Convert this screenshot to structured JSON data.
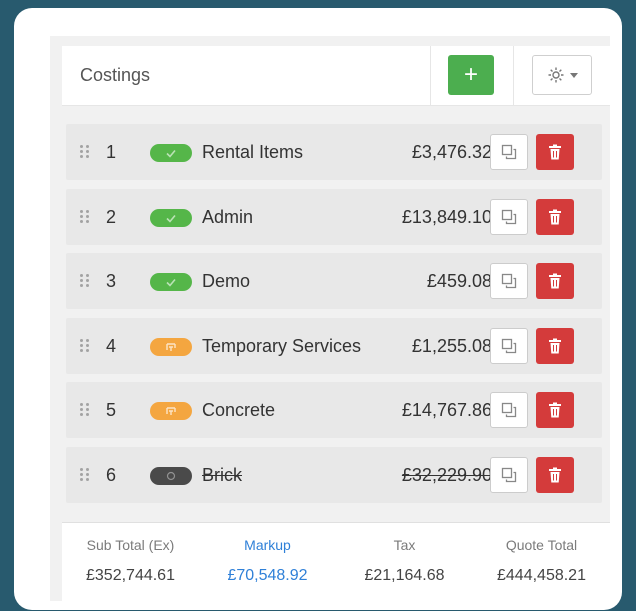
{
  "header": {
    "title": "Costings",
    "add_label": "+",
    "settings_icon": "gear-icon"
  },
  "colors": {
    "add": "#4cae4f",
    "delete": "#d43b3b",
    "status_complete": "#55b649",
    "status_pending": "#f4a640",
    "status_removed": "#4a4a4a",
    "markup": "#2f80d8"
  },
  "rows": [
    {
      "index": "1",
      "status": "complete",
      "status_icon": "check-icon",
      "name": "Rental Items",
      "amount": "£3,476.32",
      "struck": false
    },
    {
      "index": "2",
      "status": "complete",
      "status_icon": "check-icon",
      "name": "Admin",
      "amount": "£13,849.10",
      "struck": false
    },
    {
      "index": "3",
      "status": "complete",
      "status_icon": "check-icon",
      "name": "Demo",
      "amount": "£459.08",
      "struck": false
    },
    {
      "index": "4",
      "status": "pending",
      "status_icon": "pending-icon",
      "name": "Temporary Services",
      "amount": "£1,255.08",
      "struck": false
    },
    {
      "index": "5",
      "status": "pending",
      "status_icon": "pending-icon",
      "name": "Concrete",
      "amount": "£14,767.86",
      "struck": false
    },
    {
      "index": "6",
      "status": "removed",
      "status_icon": "circle-icon",
      "name": "Brick",
      "amount": "£32,229.90",
      "struck": true
    }
  ],
  "totals": {
    "subtotal_label": "Sub Total (Ex)",
    "subtotal_value": "£352,744.61",
    "markup_label": "Markup",
    "markup_value": "£70,548.92",
    "tax_label": "Tax",
    "tax_value": "£21,164.68",
    "quote_label": "Quote Total",
    "quote_value": "£444,458.21"
  }
}
